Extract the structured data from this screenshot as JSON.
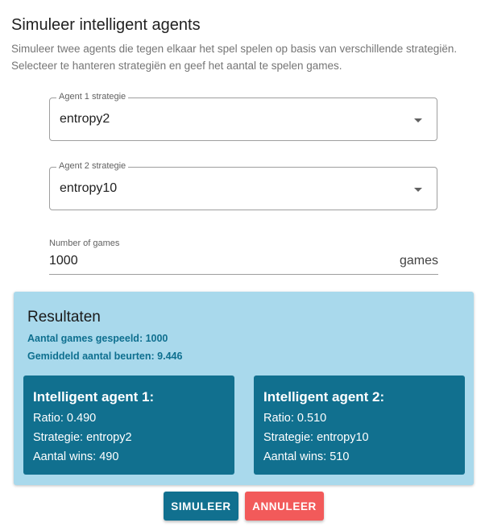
{
  "header": {
    "title": "Simuleer intelligent agents",
    "description_lines": [
      "Simuleer twee agents die tegen elkaar het spel spelen op basis van verschillende strategiën.",
      "Selecteer te hanteren strategiën en geef het aantal te spelen games."
    ]
  },
  "form": {
    "agent1": {
      "label": "Agent 1 strategie",
      "value": "entropy2"
    },
    "agent2": {
      "label": "Agent 2 strategie",
      "value": "entropy10"
    },
    "games": {
      "label": "Number of games",
      "value": "1000",
      "suffix": "games"
    }
  },
  "results": {
    "title": "Resultaten",
    "games_played": "Aantal games gespeeld: 1000",
    "average_turns": "Gemiddeld aantal beurten: 9.446",
    "agents": [
      {
        "title": "Intelligent agent 1:",
        "ratio": "Ratio: 0.490",
        "strategy": "Strategie: entropy2",
        "wins": "Aantal wins: 490"
      },
      {
        "title": "Intelligent agent 2:",
        "ratio": "Ratio: 0.510",
        "strategy": "Strategie: entropy10",
        "wins": "Aantal wins: 510"
      }
    ]
  },
  "actions": {
    "simulate_label": "SIMULEER",
    "cancel_label": "ANNULEER"
  },
  "icons": {
    "dropdown": "chevron-down-icon"
  },
  "colors": {
    "results_bg": "#a9d9ec",
    "card_bg": "#11708f",
    "primary": "#11708f",
    "danger": "#f25a5a"
  }
}
